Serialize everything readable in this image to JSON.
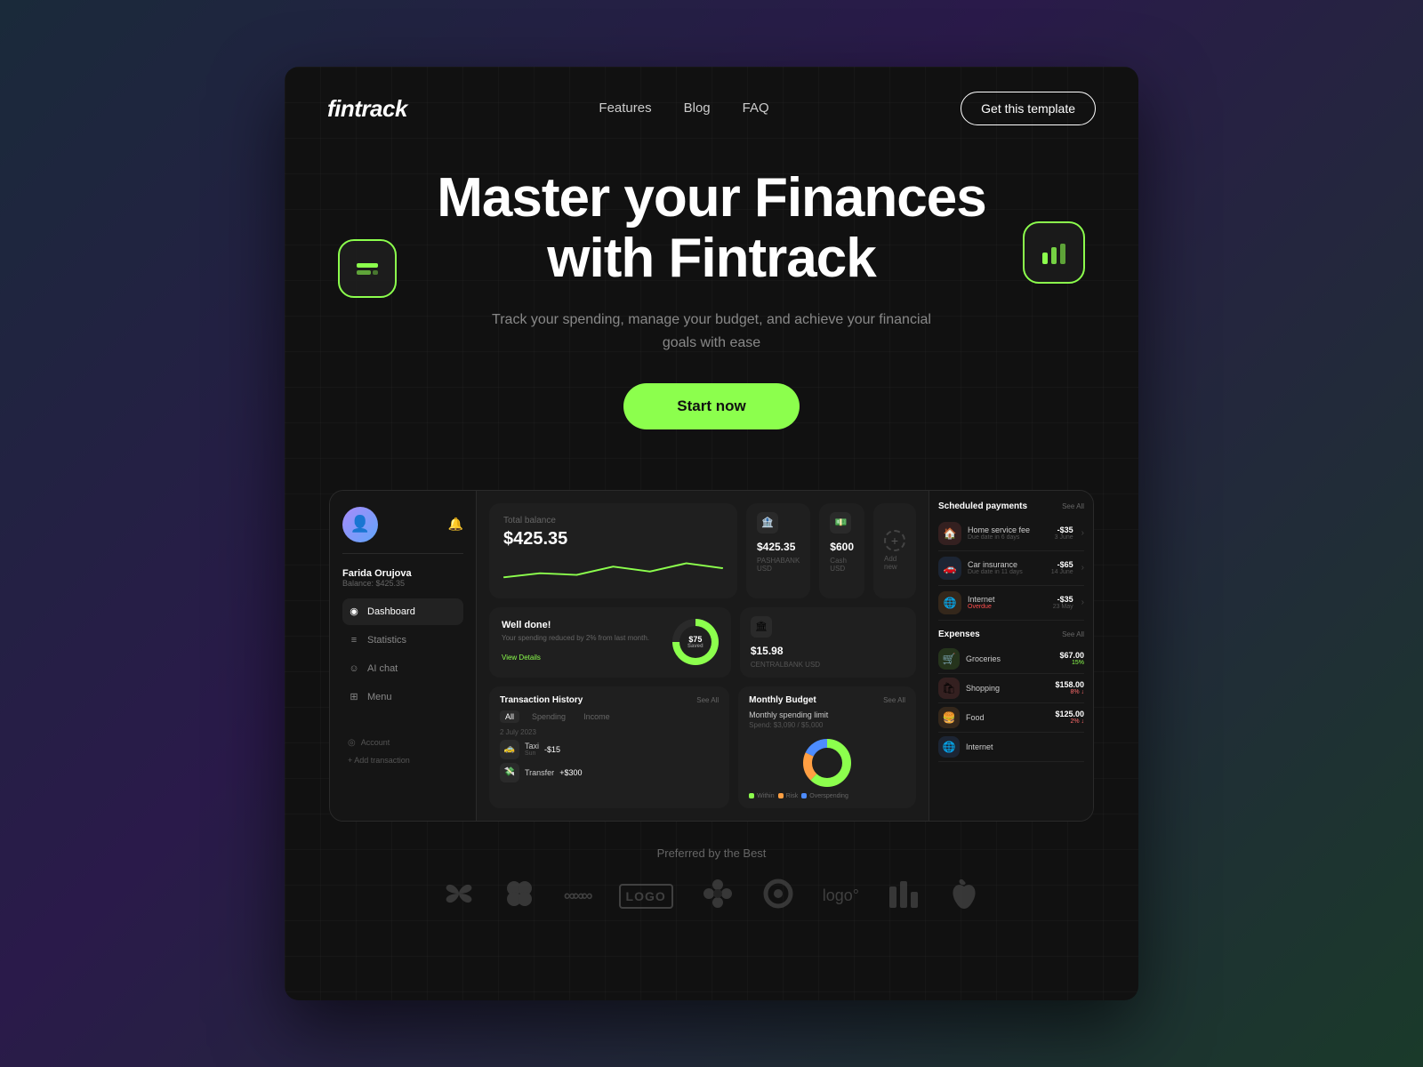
{
  "meta": {
    "bg_gradient": "linear-gradient(135deg, #1a2a3a 0%, #2a1a4a 40%, #1a3a2a 100%)"
  },
  "nav": {
    "logo": "fintrack",
    "links": [
      "Features",
      "Blog",
      "FAQ"
    ],
    "cta_label": "Get this template"
  },
  "hero": {
    "title_line1": "Master your Finances",
    "title_line2": "with Fintrack",
    "subtitle": "Track your spending, manage your budget, and achieve your financial goals with ease",
    "cta_label": "Start now"
  },
  "float_left_icon": "↔",
  "float_right_icon": "📊",
  "dashboard": {
    "sidebar": {
      "user_name": "Farida Orujova",
      "user_balance": "Balance: $425.35",
      "menu_items": [
        {
          "label": "Dashboard",
          "icon": "◉",
          "active": true
        },
        {
          "label": "Statistics",
          "icon": "≡"
        },
        {
          "label": "AI chat",
          "icon": "☺"
        },
        {
          "label": "Menu",
          "icon": "⊞"
        }
      ],
      "account_label": "Account",
      "add_transaction": "+ Add transaction"
    },
    "balance_card": {
      "label": "Total balance",
      "amount": "$425.35"
    },
    "accounts": [
      {
        "icon": "🏦",
        "amount": "$425.35",
        "label": "PASHABANK USD"
      },
      {
        "icon": "💵",
        "amount": "$600",
        "label": "Cash USD"
      }
    ],
    "well_done": {
      "title": "Well done!",
      "desc": "Your spending reduced by 2% from last month.",
      "link": "View Details",
      "saved": "$75",
      "saved_label": "Saved"
    },
    "centralbank": {
      "icon": "🏛",
      "amount": "$15.98",
      "label": "CENTRALBANK USD"
    },
    "add_new_label": "Add new",
    "transaction_history": {
      "title": "Transaction History",
      "see_all": "See All",
      "tabs": [
        "All",
        "Spending",
        "Income"
      ],
      "active_tab": "All",
      "date": "2 July 2023",
      "transactions": [
        {
          "icon": "🚕",
          "name": "Taxi",
          "sub": "Sun",
          "amount": "-$15"
        },
        {
          "icon": "💸",
          "name": "Transfer",
          "sub": "",
          "amount": "+$300"
        }
      ]
    },
    "monthly_budget": {
      "title": "Monthly Budget",
      "see_all": "See All",
      "label": "Monthly spending limit",
      "spend_text": "Spend: $3,090 / $5,000",
      "donut": {
        "within": 62,
        "risk": 20,
        "overspending": 18
      },
      "legend": [
        {
          "label": "Within",
          "color": "#8cff4d"
        },
        {
          "label": "Risk",
          "color": "#ff9f43"
        },
        {
          "label": "Overspending",
          "color": "#4d8cff"
        }
      ]
    },
    "scheduled_payments": {
      "title": "Scheduled payments",
      "see_all": "See All",
      "items": [
        {
          "icon": "🏠",
          "bg": "#ff6b6b",
          "name": "Home service fee",
          "due": "Due date in 6 days",
          "amount": "-$35",
          "date": "3 June"
        },
        {
          "icon": "🚗",
          "bg": "#4d8cff",
          "name": "Car insurance",
          "due": "Due date in 11 days",
          "amount": "-$65",
          "date": "14 June"
        },
        {
          "icon": "🌐",
          "bg": "#ff9f43",
          "name": "Internet",
          "due": "Overdue",
          "overdue": true,
          "amount": "-$35",
          "date": "23 May"
        }
      ]
    },
    "expenses": {
      "title": "Expenses",
      "see_all": "See All",
      "items": [
        {
          "icon": "🛒",
          "bg": "#8cff4d",
          "name": "Groceries",
          "amount": "$67.00",
          "pct": "15%",
          "trend": "up"
        },
        {
          "icon": "🛍",
          "bg": "#ff6b6b",
          "name": "Shopping",
          "amount": "$158.00",
          "pct": "8% ↓",
          "trend": "down"
        },
        {
          "icon": "🍔",
          "bg": "#ff9f43",
          "name": "Food",
          "amount": "$125.00",
          "pct": "2% ↓",
          "trend": "down"
        },
        {
          "icon": "🌐",
          "bg": "#4d8cff",
          "name": "Internet",
          "amount": "",
          "pct": "",
          "trend": ""
        }
      ]
    }
  },
  "preferred": {
    "title": "Preferred by the Best",
    "logos": [
      "🦋",
      "🐞",
      "∞∞∞",
      "LOGO",
      "🌸",
      "⊙",
      "logo°",
      "📊",
      "🍎"
    ]
  }
}
